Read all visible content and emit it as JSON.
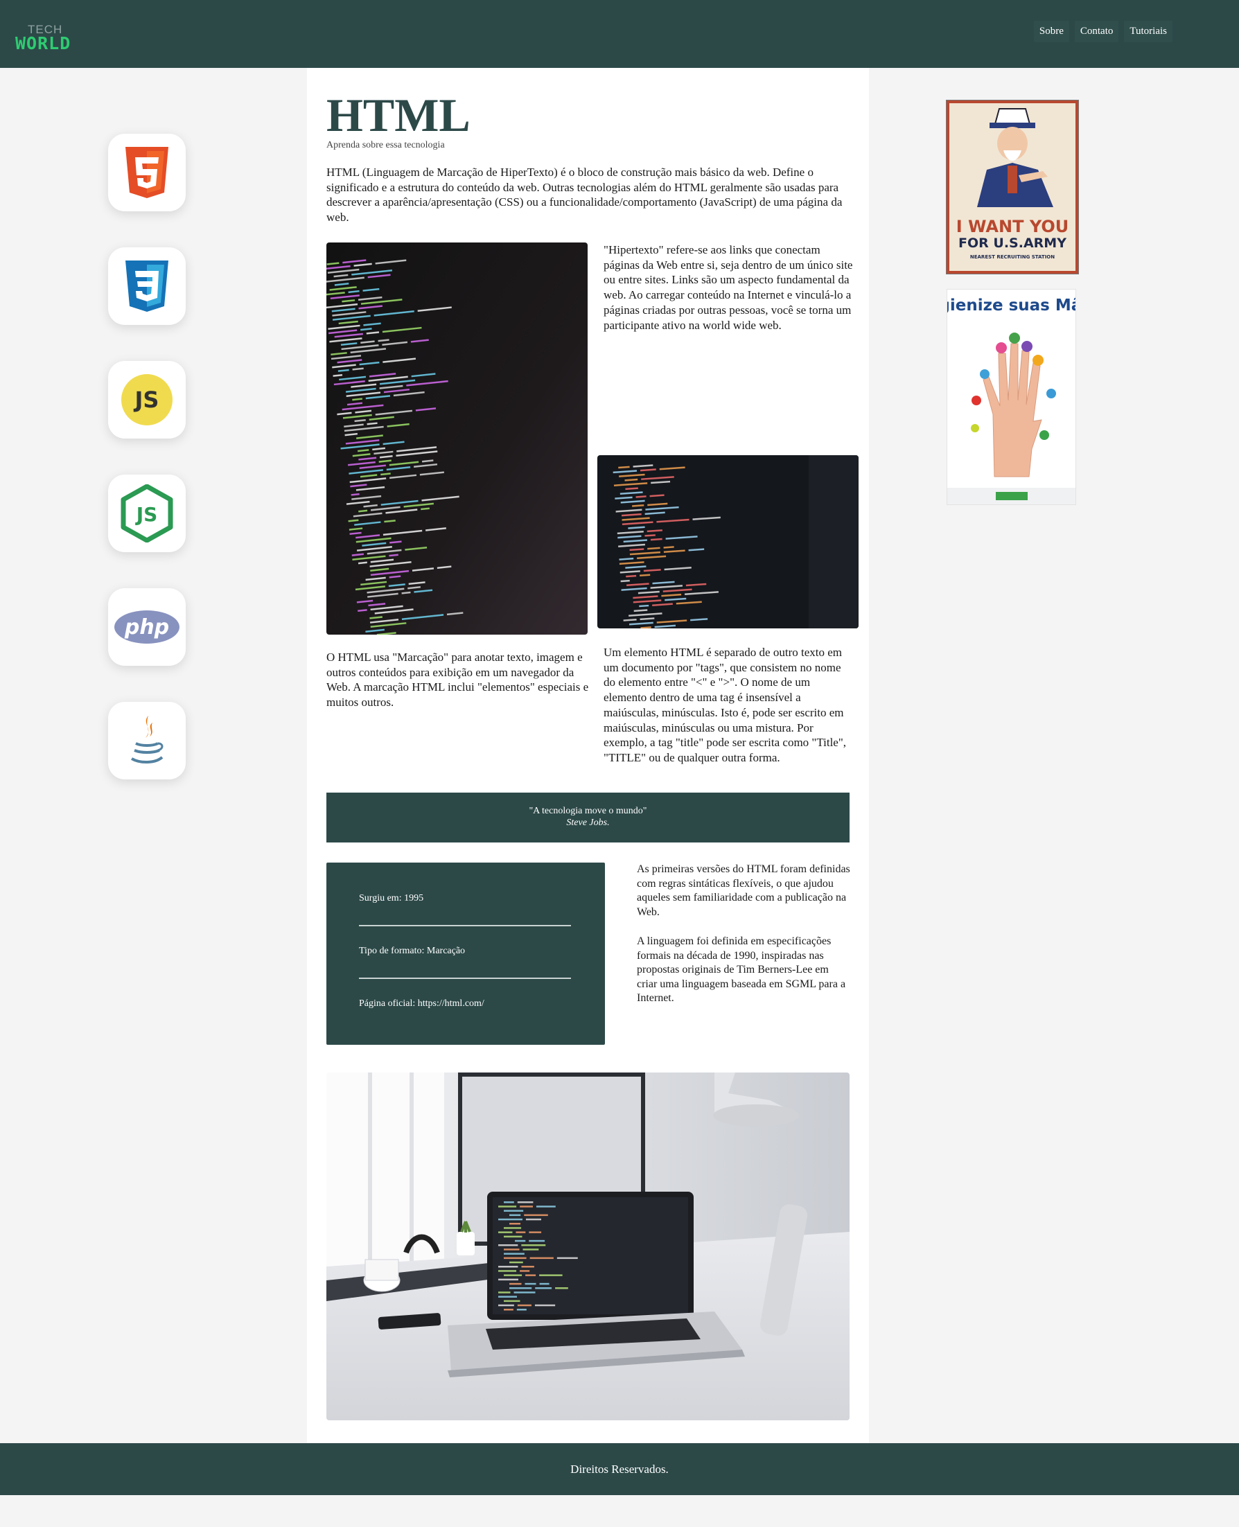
{
  "header": {
    "logo_top": "TECH",
    "logo_bottom": "WORLD",
    "nav": [
      "Sobre",
      "Contato",
      "Tutoriais"
    ]
  },
  "sidebar_icons": [
    "html5-logo-icon",
    "css3-logo-icon",
    "javascript-logo-icon",
    "nodejs-logo-icon",
    "php-logo-icon",
    "java-logo-icon"
  ],
  "main": {
    "title": "HTML",
    "subtitle": "Aprenda sobre essa tecnologia",
    "intro": "HTML (Linguagem de Marcação de HiperTexto) é o bloco de construção mais básico da web. Define o significado e a estrutura do conteúdo da web. Outras tecnologias além do HTML geralmente são usadas para descrever a aparência/apresentação (CSS) ou a funcionalidade/comportamento (JavaScript) de uma página da web.",
    "hypertext": "\"Hipertexto\" refere-se aos links que conectam páginas da Web entre si, seja dentro de um único site ou entre sites. Links são um aspecto fundamental da web. Ao carregar conteúdo na Internet e vinculá-lo a páginas criadas por outras pessoas, você se torna um participante ativo na world wide web.",
    "markup": "O HTML usa \"Marcação\" para anotar texto, imagem e outros conteúdos para exibição em um navegador da Web. A marcação HTML inclui \"elementos\" especiais e muitos outros.",
    "element": "Um elemento HTML é separado de outro texto em um documento por \"tags\", que consistem no nome do elemento entre \"<\" e \">\". O nome de um elemento dentro de uma tag é insensível a maiúsculas, minúsculas. Isto é, pode ser escrito em maiúsculas, minúsculas ou uma mistura. Por exemplo, a tag \"title\" pode ser escrita como \"Title\", \"TITLE\" ou de qualquer outra forma.",
    "quote": {
      "text": "\"A tecnologia move o mundo\"",
      "author": "Steve Jobs."
    },
    "facts": {
      "created": "Surgiu em: 1995",
      "format": "Tipo de formato: Marcação",
      "official": "Página oficial: https://html.com/"
    },
    "history_1": "As primeiras versões do HTML foram definidas com regras sintáticas flexíveis, o que ajudou aqueles sem familiaridade com a publicação na Web.",
    "history_2": "A linguagem foi definida em especificações formais na década de 1990, inspiradas nas propostas originais de Tim Berners-Lee em criar uma linguagem baseada em SGML para a Internet."
  },
  "ads": {
    "army_line1": "I WANT YOU",
    "army_line2": "FOR U.S.ARMY",
    "army_line3": "NEAREST RECRUITING STATION",
    "hygiene_title": "Higienize suas Mãos"
  },
  "footer": {
    "text": "Direitos Reservados."
  },
  "colors": {
    "primary": "#2c4948",
    "accent": "#2ecc71"
  }
}
